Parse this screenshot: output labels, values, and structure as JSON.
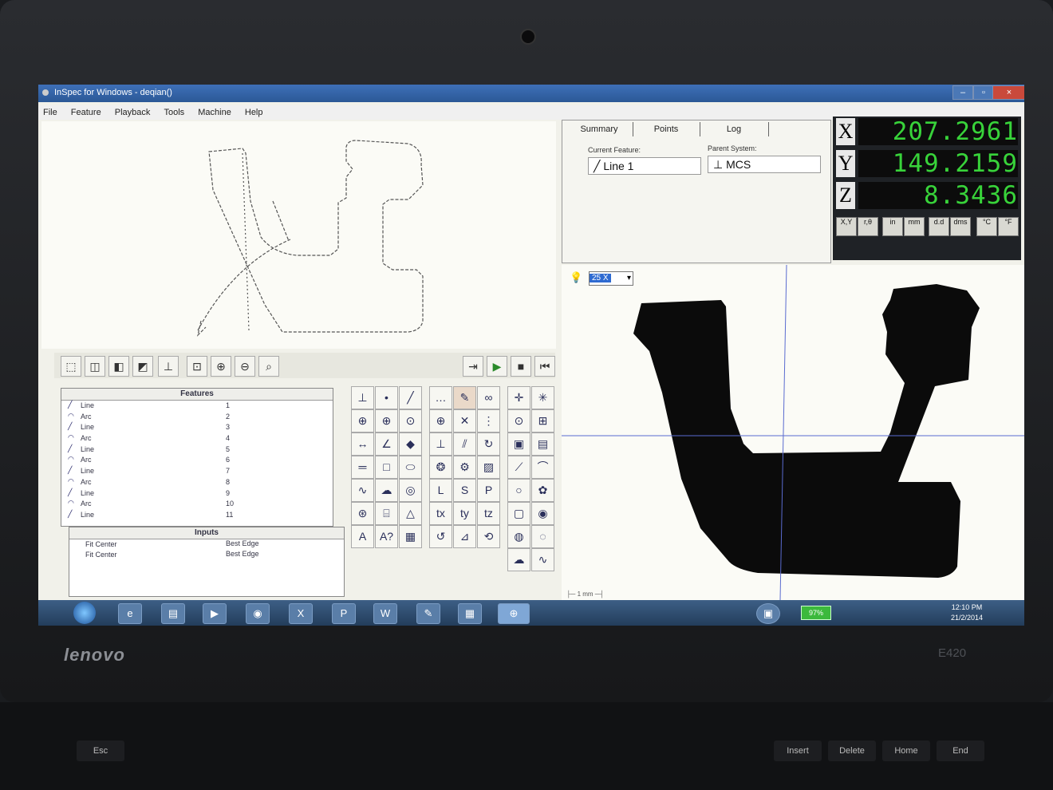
{
  "window": {
    "title": "InSpec for Windows - deqian()",
    "controls": {
      "minimize": "–",
      "maximize": "▫",
      "close": "×"
    }
  },
  "menu": [
    "File",
    "Feature",
    "Playback",
    "Tools",
    "Machine",
    "Help"
  ],
  "summary": {
    "tabs": [
      "Summary",
      "Points",
      "Log"
    ],
    "current_feature_label": "Current Feature:",
    "current_feature": "Line 1",
    "parent_system_label": "Parent System:",
    "parent_system": "MCS"
  },
  "dro": {
    "x_label": "X",
    "x_value": "207.2961",
    "y_label": "Y",
    "y_value": "149.2159",
    "z_label": "Z",
    "z_value": "8.3436",
    "unit_buttons": [
      "X,Y",
      "r,θ",
      "in",
      "mm",
      "d.d",
      "dms",
      "°C",
      "°F"
    ],
    "value_color": "#38d33a"
  },
  "features": {
    "header": "Features",
    "items": [
      {
        "name": "Line",
        "num": "1",
        "icon": "line-icon"
      },
      {
        "name": "Arc",
        "num": "2",
        "icon": "arc-icon"
      },
      {
        "name": "Line",
        "num": "3",
        "icon": "line-icon"
      },
      {
        "name": "Arc",
        "num": "4",
        "icon": "arc-icon"
      },
      {
        "name": "Line",
        "num": "5",
        "icon": "line-icon"
      },
      {
        "name": "Arc",
        "num": "6",
        "icon": "arc-icon"
      },
      {
        "name": "Line",
        "num": "7",
        "icon": "line-icon"
      },
      {
        "name": "Arc",
        "num": "8",
        "icon": "arc-icon"
      },
      {
        "name": "Line",
        "num": "9",
        "icon": "line-icon"
      },
      {
        "name": "Arc",
        "num": "10",
        "icon": "arc-icon"
      },
      {
        "name": "Line",
        "num": "11",
        "icon": "line-icon"
      }
    ]
  },
  "inputs": {
    "header": "Inputs",
    "items": [
      {
        "a": "Fit Center",
        "b": "Best Edge"
      },
      {
        "a": "Fit Center",
        "b": "Best Edge"
      }
    ]
  },
  "video": {
    "zoom": "25 X",
    "scale_label": "1 mm"
  },
  "taskbar": {
    "battery": "97%",
    "time": "12:10 PM",
    "date": "21/2/2014"
  },
  "laptop": {
    "brand": "lenovo",
    "model": "E420"
  },
  "keys": [
    "Esc",
    "Insert",
    "Delete",
    "Home",
    "End"
  ]
}
